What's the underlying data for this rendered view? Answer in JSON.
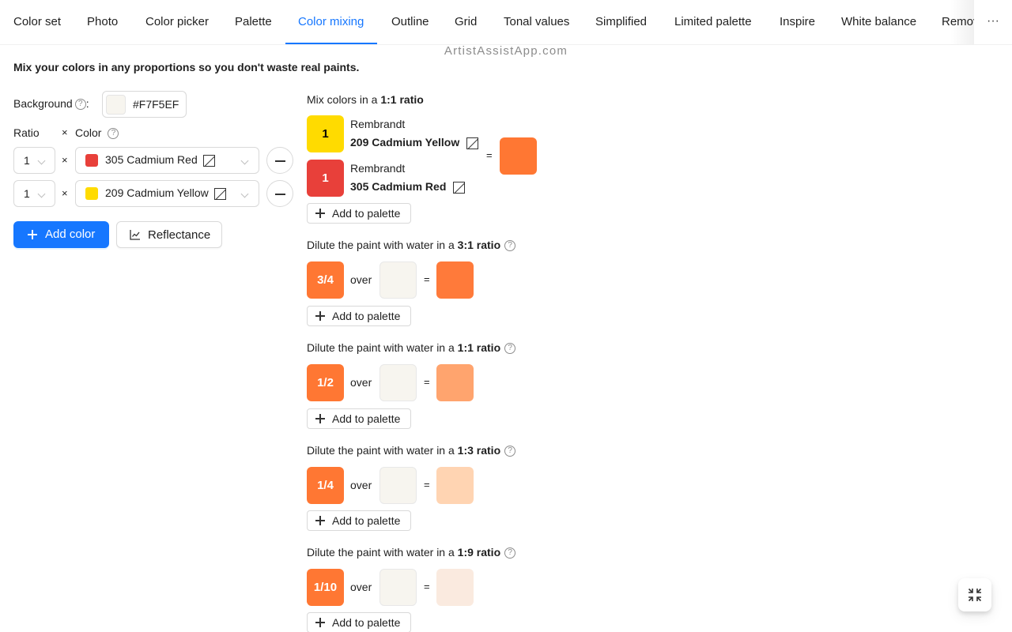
{
  "tabs": [
    {
      "label": "Color set"
    },
    {
      "label": "Photo"
    },
    {
      "label": "Color picker"
    },
    {
      "label": "Palette"
    },
    {
      "label": "Color mixing"
    },
    {
      "label": "Outline"
    },
    {
      "label": "Grid"
    },
    {
      "label": "Tonal values"
    },
    {
      "label": "Simplified"
    },
    {
      "label": "Limited palette"
    },
    {
      "label": "Inspire"
    },
    {
      "label": "White balance"
    },
    {
      "label": "Remov"
    }
  ],
  "active_tab": "Color mixing",
  "more_label": "···",
  "site": "ArtistAssistApp.com",
  "intro": "Mix your colors in any proportions so you don't waste real paints.",
  "form": {
    "background_label": "Background",
    "background_sep": ":",
    "background_value": "#F7F5EF",
    "ratio_label": "Ratio",
    "times": "×",
    "color_label": "Color",
    "help_icon": "?",
    "rows": [
      {
        "ratio": "1",
        "color_name": "305 Cadmium Red",
        "swatch": "#E8403A"
      },
      {
        "ratio": "1",
        "color_name": "209 Cadmium Yellow",
        "swatch": "#FFDB00"
      }
    ],
    "add_color": "Add color",
    "reflectance": "Reflectance"
  },
  "mix": {
    "heading_prefix": "Mix colors in a ",
    "heading_ratio": "1:1 ratio",
    "eq": "=",
    "paints": [
      {
        "parts": "1",
        "brand": "Rembrandt",
        "name": "209 Cadmium Yellow",
        "color": "#FFDB00",
        "text_color": "#000000"
      },
      {
        "parts": "1",
        "brand": "Rembrandt",
        "name": "305 Cadmium Red",
        "color": "#E8403A",
        "text_color": "#ffffff"
      }
    ],
    "result_color": "#FF7733",
    "add_to_palette": "Add to palette"
  },
  "dilutions": [
    {
      "prefix": "Dilute the paint with water in a ",
      "ratio": "3:1 ratio",
      "fraction": "3/4",
      "over": "over",
      "result_color": "#FF7A3A"
    },
    {
      "prefix": "Dilute the paint with water in a ",
      "ratio": "1:1 ratio",
      "fraction": "1/2",
      "over": "over",
      "result_color": "#FFA46E"
    },
    {
      "prefix": "Dilute the paint with water in a ",
      "ratio": "1:3 ratio",
      "fraction": "1/4",
      "over": "over",
      "result_color": "#FFD4B2"
    },
    {
      "prefix": "Dilute the paint with water in a ",
      "ratio": "1:9 ratio",
      "fraction": "1/10",
      "over": "over",
      "result_color": "#FAEADF"
    }
  ],
  "colors": {
    "accent": "#1677ff",
    "paint_base": "#FF7733",
    "background": "#F7F5EF"
  },
  "icons": {
    "help": "question-circle-icon",
    "opacity": "opacity-square-icon",
    "chevron": "chevron-down-icon",
    "minus": "minus-circle-icon",
    "plus": "plus-icon",
    "chart": "line-chart-icon",
    "more": "ellipsis-icon",
    "fab": "fullscreen-exit-icon"
  }
}
